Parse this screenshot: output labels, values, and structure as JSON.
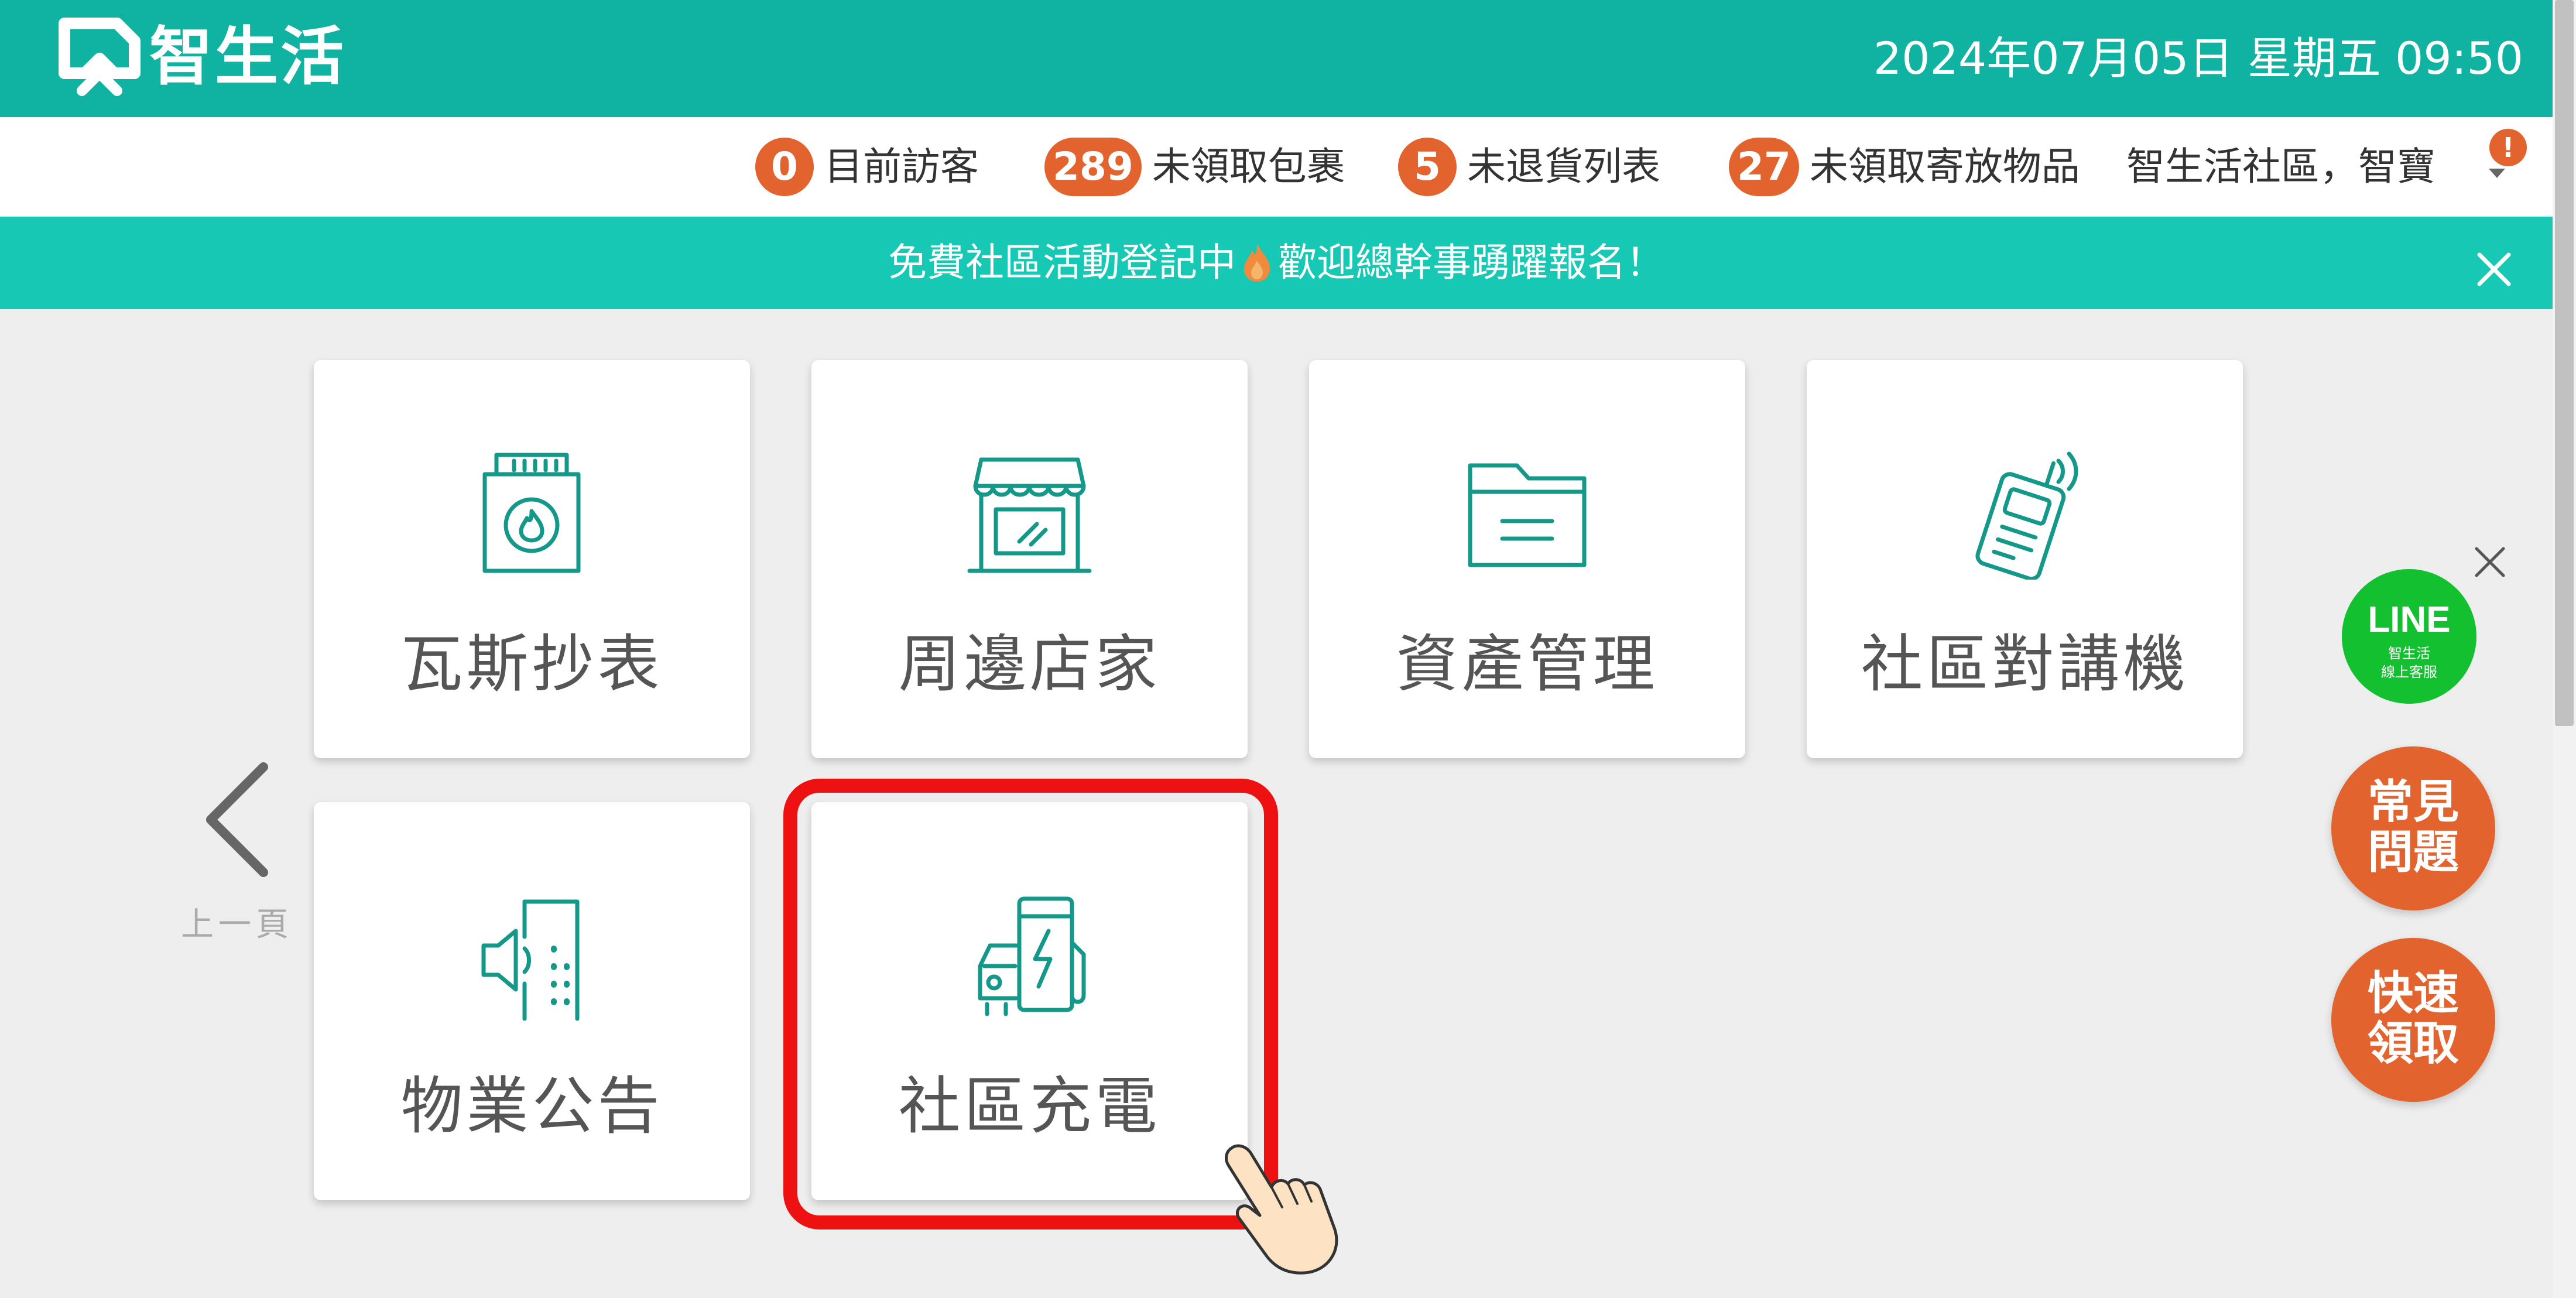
{
  "header": {
    "brand": "智生活",
    "datetime": "2024年07月05日 星期五 09:50",
    "logo_icon": "house-logo-icon"
  },
  "status": [
    {
      "count": "0",
      "label": "目前訪客"
    },
    {
      "count": "289",
      "label": "未領取包裹"
    },
    {
      "count": "5",
      "label": "未退貨列表"
    },
    {
      "count": "27",
      "label": "未領取寄放物品"
    }
  ],
  "account": {
    "community": "智生活社區，智寶",
    "alert": "!"
  },
  "announcement": {
    "text_before": "免費社區活動登記中",
    "text_after": "歡迎總幹事踴躍報名！"
  },
  "tiles": [
    {
      "label": "瓦斯抄表",
      "icon": "gas-meter-icon"
    },
    {
      "label": "周邊店家",
      "icon": "storefront-icon"
    },
    {
      "label": "資產管理",
      "icon": "folder-icon"
    },
    {
      "label": "社區對講機",
      "icon": "walkie-talkie-icon"
    },
    {
      "label": "物業公告",
      "icon": "speaker-announcement-icon"
    },
    {
      "label": "社區充電",
      "icon": "ev-charger-icon"
    }
  ],
  "nav": {
    "prev_label": "上一頁"
  },
  "floating": {
    "line_title": "LINE",
    "line_sub1": "智生活",
    "line_sub2": "線上客服",
    "faq_line1": "常見",
    "faq_line2": "問題",
    "quick_line1": "快速",
    "quick_line2": "領取"
  },
  "colors": {
    "header": "#10b3a1",
    "announcement": "#17c8b4",
    "accent": "#e2632d",
    "icon": "#14988a",
    "highlight": "#ee1111",
    "line_green": "#13c130"
  }
}
